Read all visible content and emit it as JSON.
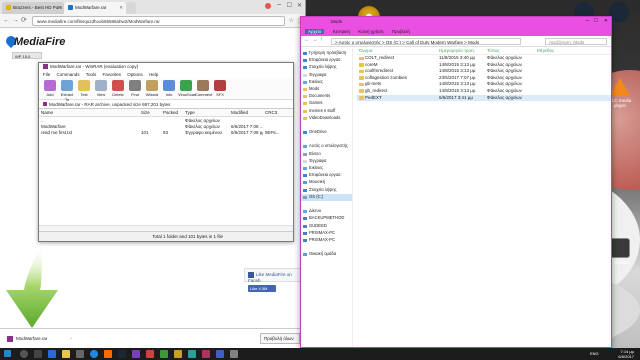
{
  "chrome": {
    "tabs": [
      {
        "label": "Brazzers - Best HD Porn",
        "active": false
      },
      {
        "label": "ModWarfare.rar",
        "active": true
      },
      {
        "label": "",
        "active": false
      }
    ],
    "url": "www.mediafire.com/file/quzdhoob65586ahw2/ModWarfare.rar"
  },
  "mediafire": {
    "logo": "MediaFire",
    "sub_label": "WP 15.0"
  },
  "winrar": {
    "title": "ModWarfare.rar - WinRAR (evaluation copy)",
    "menu": [
      "File",
      "Commands",
      "Tools",
      "Favorites",
      "Options",
      "Help"
    ],
    "tools": [
      {
        "label": "Add",
        "color": "#b56ad6"
      },
      {
        "label": "Extract To",
        "color": "#6fa3d8"
      },
      {
        "label": "Test",
        "color": "#e0c15b"
      },
      {
        "label": "View",
        "color": "#9fb1c6"
      },
      {
        "label": "Delete",
        "color": "#d05050"
      },
      {
        "label": "Find",
        "color": "#7f7f7f"
      },
      {
        "label": "Wizard",
        "color": "#c0a060"
      },
      {
        "label": "Info",
        "color": "#5b8dd9"
      },
      {
        "label": "VirusScan",
        "color": "#3aa34d"
      },
      {
        "label": "Comment",
        "color": "#9a7a5a"
      },
      {
        "label": "SFX",
        "color": "#b04040"
      }
    ],
    "path": "ModWarfare.rar - RAR archive, unpacked size 697,201 bytes",
    "columns": [
      "Name",
      "Size",
      "Packed",
      "Type",
      "Modified",
      "CRC3"
    ],
    "rows": [
      {
        "name": "..",
        "size": "",
        "packed": "",
        "type": "Φάκελος αρχείων",
        "modified": "",
        "crc": ""
      },
      {
        "name": "ModWarfare",
        "size": "",
        "packed": "",
        "type": "Φάκελος αρχείων",
        "modified": "6/6/2017 7:08 ...",
        "crc": ""
      },
      {
        "name": "read me first.txt",
        "size": "101",
        "packed": "93",
        "type": "Έγγραφο κειμένου",
        "modified": "6/6/2017 7:08 μμ",
        "crc": "9EF6..."
      }
    ],
    "status": "Total 1 folder and 101 bytes in 1 file"
  },
  "facebook": {
    "widget_text": "Like MediaFire on Faceb",
    "like_label": "Like 4.5M"
  },
  "download_bar": {
    "file": "ModWarfare.rar",
    "show_all": "Προβολή όλων"
  },
  "explorer": {
    "title": "Mods",
    "ribbon": [
      "Αρχείο",
      "Κεντρική",
      "Κοινή χρήση",
      "Προβολή"
    ],
    "breadcrumb": "> Αυτός ο υπολογιστής > OS (C:) > Call of Duty Modern Warfare > Mods",
    "search_placeholder": "Αναζήτηση: Mods",
    "nav": [
      {
        "label": "Γρήγορη πρόσβαση",
        "color": "#3a86d6"
      },
      {
        "label": "Επιφάνεια εργασ.",
        "color": "#3a86d6"
      },
      {
        "label": "Στοιχεία λήψης",
        "color": "#3a86d6"
      },
      {
        "label": "Έγγραφα",
        "color": "#d9d9d9"
      },
      {
        "label": "Εικόνες",
        "color": "#5ba6e0"
      },
      {
        "label": "Mods",
        "color": "#e8c35a"
      },
      {
        "label": "Documents",
        "color": "#e8c35a"
      },
      {
        "label": "Games",
        "color": "#e8c35a"
      },
      {
        "label": "memes n stuff",
        "color": "#e8c35a"
      },
      {
        "label": "VideoDownloads",
        "color": "#e8c35a"
      },
      {
        "label": "",
        "color": "#ffffff"
      },
      {
        "label": "OneDrive",
        "color": "#3a86d6"
      },
      {
        "label": "",
        "color": "#ffffff"
      },
      {
        "label": "Αυτός ο υπολογιστής",
        "color": "#5ba6e0"
      },
      {
        "label": "Βίντεο",
        "color": "#8aa0b8"
      },
      {
        "label": "Έγγραφα",
        "color": "#d9d9d9"
      },
      {
        "label": "Εικόνες",
        "color": "#5ba6e0"
      },
      {
        "label": "Επιφάνεια εργασ.",
        "color": "#3a86d6"
      },
      {
        "label": "Μουσική",
        "color": "#4fa3d9"
      },
      {
        "label": "Στοιχεία λήψης",
        "color": "#3a86d6"
      },
      {
        "label": "OS (C:)",
        "color": "#7f9fbf"
      },
      {
        "label": "",
        "color": "#ffffff"
      },
      {
        "label": "Δίκτυο",
        "color": "#5ba6e0"
      },
      {
        "label": "BACKUPMETHOD",
        "color": "#4a7fbf"
      },
      {
        "label": "GUDEED",
        "color": "#4a7fbf"
      },
      {
        "label": "PRISMAX-PC",
        "color": "#4a7fbf"
      },
      {
        "label": "PRISMAX-PC",
        "color": "#4a7fbf"
      },
      {
        "label": "",
        "color": "#ffffff"
      },
      {
        "label": "Οικιακή ομάδα",
        "color": "#4fa3d9"
      }
    ],
    "columns": [
      "Όνομα",
      "Ημερομηνία τροπ.",
      "Τύπος",
      "Μέγεθος"
    ],
    "rows": [
      {
        "name": "COLT_redirect",
        "date": "11/8/2015 3:40 μμ",
        "type": "Φάκελος αρχείων",
        "size": "",
        "file": false,
        "selected": false
      },
      {
        "name": "coreM",
        "date": "14/8/2015 3:13 μμ",
        "type": "Φάκελος αρχείων",
        "size": "",
        "file": false,
        "selected": false
      },
      {
        "name": "coolfmredirect",
        "date": "14/8/2015 3:13 μμ",
        "type": "Φάκελος αρχείων",
        "size": "",
        "file": false,
        "selected": false
      },
      {
        "name": "coflagestion zombies",
        "date": "23/5/2017 7:07 μμ",
        "type": "Φάκελος αρχείων",
        "size": "",
        "file": false,
        "selected": false
      },
      {
        "name": "gb-mets",
        "date": "14/8/2015 3:13 μμ",
        "type": "Φάκελος αρχείων",
        "size": "",
        "file": false,
        "selected": false
      },
      {
        "name": "gb_redirect",
        "date": "14/8/2015 3:13 μμ",
        "type": "Φάκελος αρχείων",
        "size": "",
        "file": false,
        "selected": false
      },
      {
        "name": "PedEXT",
        "date": "6/6/2017 3:41 μμ",
        "type": "Φάκελος αρχείων",
        "size": "",
        "file": false,
        "selected": true
      }
    ]
  },
  "desktop": {
    "icons": [
      {
        "label": "",
        "color": "#1b2838"
      },
      {
        "label": "Steam",
        "color": "#1b2838"
      },
      {
        "label": "VLC media player",
        "color": "#f28a1b"
      },
      {
        "label": "Calculator",
        "color": "#3a3a3a"
      }
    ]
  },
  "taskbar": {
    "time": "7:14 μμ",
    "date": "6/6/2017",
    "lang": "ENG"
  }
}
